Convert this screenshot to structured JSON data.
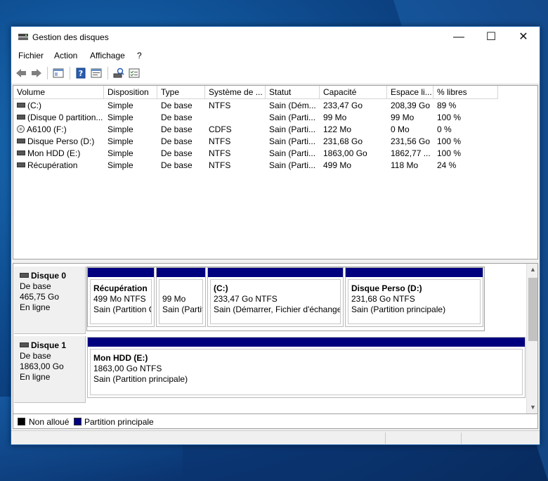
{
  "window": {
    "title": "Gestion des disques",
    "controls": {
      "minimize": "—",
      "maximize": "☐",
      "close": "✕"
    }
  },
  "menu": {
    "items": [
      "Fichier",
      "Action",
      "Affichage",
      "?"
    ]
  },
  "toolbar": {
    "icons": [
      "back-arrow-icon",
      "forward-arrow-icon",
      "console-tree-icon",
      "help-icon",
      "properties-icon",
      "rescan-icon",
      "checklist-icon"
    ]
  },
  "volume_list": {
    "columns": [
      "Volume",
      "Disposition",
      "Type",
      "Système de ...",
      "Statut",
      "Capacité",
      "Espace li...",
      "% libres"
    ],
    "rows": [
      {
        "icon": "drive",
        "volume": "(C:)",
        "disposition": "Simple",
        "type": "De base",
        "fs": "NTFS",
        "status": "Sain (Dém...",
        "capacity": "233,47 Go",
        "free": "208,39 Go",
        "pct": "89 %"
      },
      {
        "icon": "drive",
        "volume": "(Disque 0 partition...",
        "disposition": "Simple",
        "type": "De base",
        "fs": "",
        "status": "Sain (Parti...",
        "capacity": "99 Mo",
        "free": "99 Mo",
        "pct": "100 %"
      },
      {
        "icon": "cd",
        "volume": "A6100 (F:)",
        "disposition": "Simple",
        "type": "De base",
        "fs": "CDFS",
        "status": "Sain (Parti...",
        "capacity": "122 Mo",
        "free": "0 Mo",
        "pct": "0 %"
      },
      {
        "icon": "drive",
        "volume": "Disque Perso (D:)",
        "disposition": "Simple",
        "type": "De base",
        "fs": "NTFS",
        "status": "Sain (Parti...",
        "capacity": "231,68 Go",
        "free": "231,56 Go",
        "pct": "100 %"
      },
      {
        "icon": "drive",
        "volume": "Mon HDD (E:)",
        "disposition": "Simple",
        "type": "De base",
        "fs": "NTFS",
        "status": "Sain (Parti...",
        "capacity": "1863,00 Go",
        "free": "1862,77 ...",
        "pct": "100 %"
      },
      {
        "icon": "drive",
        "volume": "Récupération",
        "disposition": "Simple",
        "type": "De base",
        "fs": "NTFS",
        "status": "Sain (Parti...",
        "capacity": "499 Mo",
        "free": "118 Mo",
        "pct": "24 %"
      }
    ]
  },
  "disks": [
    {
      "name": "Disque 0",
      "type": "De base",
      "size": "465,75 Go",
      "state": "En ligne",
      "partitions": [
        {
          "title": "Récupération",
          "size": "499 Mo NTFS",
          "status": "Sain (Partition C"
        },
        {
          "title": "",
          "size": "99 Mo",
          "status": "Sain (Partit"
        },
        {
          "title": "(C:)",
          "size": "233,47 Go NTFS",
          "status": "Sain (Démarrer, Fichier d'échange,"
        },
        {
          "title": "Disque Perso  (D:)",
          "size": "231,68 Go NTFS",
          "status": "Sain (Partition principale)"
        }
      ]
    },
    {
      "name": "Disque 1",
      "type": "De base",
      "size": "1863,00 Go",
      "state": "En ligne",
      "partitions": [
        {
          "title": "Mon HDD  (E:)",
          "size": "1863,00 Go NTFS",
          "status": "Sain (Partition principale)"
        }
      ]
    }
  ],
  "legend": [
    {
      "label": "Non alloué",
      "color": "#000000"
    },
    {
      "label": "Partition principale",
      "color": "#00007f"
    }
  ],
  "colors": {
    "partition_bar": "#00007f",
    "window_border": "#1c62ad"
  }
}
